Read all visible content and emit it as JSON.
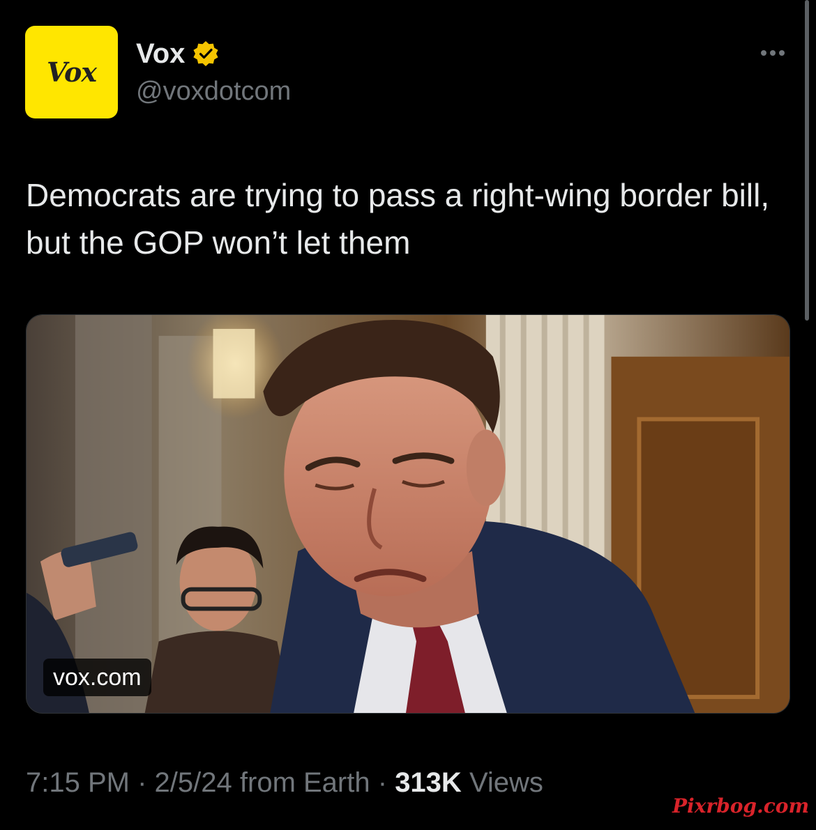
{
  "author": {
    "avatar_text": "Vox",
    "display_name": "Vox",
    "handle": "@voxdotcom",
    "verified_icon": "verified-badge-icon",
    "verified_color": "#ffcc00",
    "avatar_color": "#ffe600"
  },
  "tweet": {
    "text": "Democrats are trying to pass a right-wing border bill, but the GOP won’t let them",
    "link_card": {
      "domain": "vox.com"
    }
  },
  "meta": {
    "time": "7:15 PM",
    "separator": "·",
    "date": "2/5/24",
    "source": "from Earth",
    "views_count": "313K",
    "views_label": "Views"
  },
  "watermark": "Pixrbog.com",
  "colors": {
    "background": "#000000",
    "primary_text": "#e7e9ea",
    "secondary_text": "#71767b"
  }
}
